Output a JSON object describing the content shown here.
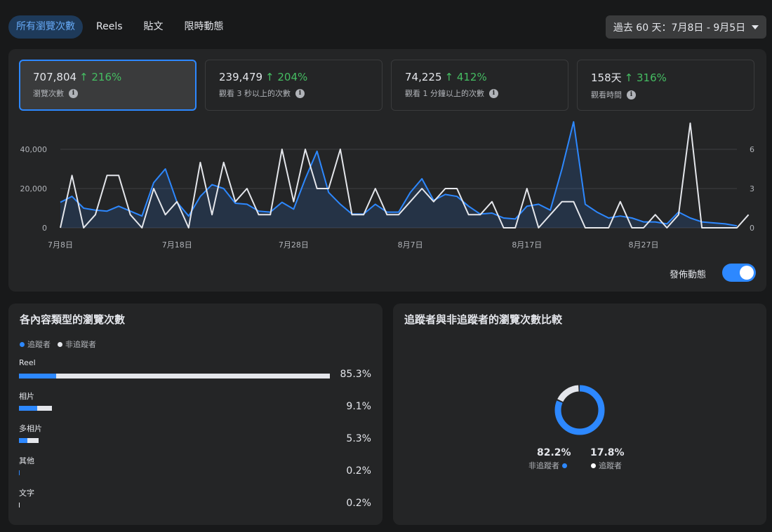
{
  "tabs": [
    {
      "label": "所有瀏覽次數",
      "active": true
    },
    {
      "label": "Reels",
      "active": false
    },
    {
      "label": "貼文",
      "active": false
    },
    {
      "label": "限時動態",
      "active": false
    }
  ],
  "date_range": "過去 60 天：7月8日 - 9月5日",
  "metrics": [
    {
      "value": "707,804",
      "delta": "↑ 216%",
      "label": "瀏覽次數"
    },
    {
      "value": "239,479",
      "delta": "↑ 204%",
      "label": "觀看 3 秒以上的次數"
    },
    {
      "value": "74,225",
      "delta": "↑ 412%",
      "label": "觀看 1 分鐘以上的次數"
    },
    {
      "value": "158天",
      "delta": "↑ 316%",
      "label": "觀看時間"
    }
  ],
  "toggle": {
    "label": "發佈動態",
    "on": true
  },
  "colors": {
    "accent": "#2d88ff",
    "positive": "#45bd62",
    "secondary": "#e4e6eb"
  },
  "chart_data": {
    "type": "line",
    "x_ticks": [
      "7月8日",
      "7月18日",
      "7月28日",
      "8月7日",
      "8月17日",
      "8月27日"
    ],
    "ylim": [
      0,
      50000
    ],
    "y_ticks": [
      "0",
      "20,000",
      "40,000"
    ],
    "y2lim": [
      0,
      7.5
    ],
    "y2_ticks": [
      "0",
      "3",
      "6"
    ],
    "grid": true,
    "series": [
      {
        "role": "views",
        "axis": "left",
        "color": "#2d88ff",
        "area": true,
        "values": [
          13000,
          16000,
          10000,
          9000,
          8500,
          11000,
          8500,
          6000,
          23000,
          30000,
          13000,
          6000,
          16000,
          22000,
          20000,
          12500,
          12000,
          8500,
          8000,
          13000,
          9500,
          25000,
          39000,
          18000,
          12000,
          7000,
          7000,
          12000,
          8000,
          8000,
          18000,
          25000,
          14000,
          17000,
          16000,
          11000,
          7000,
          7500,
          5000,
          4500,
          11000,
          12000,
          9000,
          30000,
          54000,
          12000,
          8000,
          5000,
          6000,
          5000,
          3000,
          3000,
          2000,
          8000,
          5000,
          3000,
          2500,
          2000,
          1000
        ]
      },
      {
        "role": "posts",
        "axis": "right",
        "color": "#e4e6eb",
        "area": false,
        "values": [
          0,
          4,
          0,
          1,
          4,
          4,
          1,
          0,
          3,
          1,
          2,
          0,
          5,
          1,
          5,
          2,
          3,
          1,
          1,
          6,
          2,
          6,
          3,
          3,
          6,
          1,
          1,
          3,
          1,
          1,
          2,
          3,
          2,
          3,
          3,
          1,
          1,
          2,
          0,
          0,
          3,
          0,
          1,
          2,
          2,
          0,
          0,
          0,
          2,
          0,
          0,
          1,
          0,
          1,
          8,
          0,
          0,
          0,
          0,
          1
        ]
      }
    ]
  },
  "content_type": {
    "title": "各內容類型的瀏覽次數",
    "legend": [
      "追蹤者",
      "非追蹤者"
    ],
    "rows": [
      {
        "label": "Reel",
        "percent": "85.3%",
        "value": 85.3,
        "follower_share": 0.12
      },
      {
        "label": "相片",
        "percent": "9.1%",
        "value": 9.1,
        "follower_share": 0.55
      },
      {
        "label": "多相片",
        "percent": "5.3%",
        "value": 5.3,
        "follower_share": 0.45
      },
      {
        "label": "其他",
        "percent": "0.2%",
        "value": 0.2,
        "follower_share": 1.0
      },
      {
        "label": "文字",
        "percent": "0.2%",
        "value": 0.2,
        "follower_share": 0.0
      }
    ]
  },
  "followers": {
    "title": "追蹤者與非追蹤者的瀏覽次數比較",
    "non_followers": {
      "percent": "82.2%",
      "value": 82.2,
      "label": "非追蹤者"
    },
    "followers": {
      "percent": "17.8%",
      "value": 17.8,
      "label": "追蹤者"
    }
  }
}
